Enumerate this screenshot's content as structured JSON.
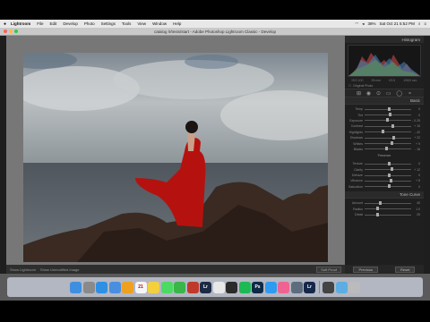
{
  "menubar": {
    "app_name": "Lightroom",
    "items": [
      "File",
      "Edit",
      "Develop",
      "Photo",
      "Settings",
      "Tools",
      "View",
      "Window",
      "Help"
    ],
    "status": {
      "battery": "38%",
      "datetime": "Sat Oct 21  5:52 PM"
    }
  },
  "window": {
    "title": "catalog lr/tests/start - Adobe Photoshop Lightroom Classic - Develop"
  },
  "panel": {
    "histogram_title": "Histogram",
    "histogram_info": [
      "ISO 100",
      "35 mm",
      "f/3.5",
      "1/500 sec"
    ],
    "original_photo": "Original Photo",
    "basic_title": "Basic",
    "treatment": "Color",
    "profile": "Adobe Color",
    "wb": "As Shot",
    "sliders": [
      {
        "label": "Temp",
        "value": "0",
        "pos": 0.5
      },
      {
        "label": "Tint",
        "value": "0",
        "pos": 0.52
      },
      {
        "label": "Exposure",
        "value": "- 0.25",
        "pos": 0.46
      },
      {
        "label": "Contrast",
        "value": "+ 15",
        "pos": 0.58
      },
      {
        "label": "Highlights",
        "value": "- 42",
        "pos": 0.36
      },
      {
        "label": "Shadows",
        "value": "+ 22",
        "pos": 0.6
      },
      {
        "label": "Whites",
        "value": "+ 9",
        "pos": 0.55
      },
      {
        "label": "Blacks",
        "value": "- 18",
        "pos": 0.44
      }
    ],
    "presence_label": "Presence",
    "presence_sliders": [
      {
        "label": "Texture",
        "value": "0",
        "pos": 0.5
      },
      {
        "label": "Clarity",
        "value": "+ 12",
        "pos": 0.56
      },
      {
        "label": "Dehaze",
        "value": "0",
        "pos": 0.5
      },
      {
        "label": "Vibrance",
        "value": "+ 8",
        "pos": 0.54
      },
      {
        "label": "Saturation",
        "value": "0",
        "pos": 0.5
      }
    ],
    "tone_curve_title": "Tone Curve",
    "detail_title": "Detail",
    "detail_sliders": [
      {
        "label": "Amount",
        "value": "40",
        "pos": 0.3
      },
      {
        "label": "Radius",
        "value": "1.0",
        "pos": 0.25
      },
      {
        "label": "Detail",
        "value": "25",
        "pos": 0.25
      }
    ],
    "previous_button": "Previous",
    "reset_button": "Reset"
  },
  "bottom_toolbar": {
    "mode": "Show Lightroom",
    "label": "Show Unmodified Image",
    "softproof": "Soft Proof"
  },
  "dock": {
    "apps": [
      {
        "name": "finder",
        "color": "#3e8fe0",
        "glyph": ""
      },
      {
        "name": "launchpad",
        "color": "#8a8a8a",
        "glyph": ""
      },
      {
        "name": "safari",
        "color": "#2f8fe3",
        "glyph": ""
      },
      {
        "name": "mail",
        "color": "#4a8ee0",
        "glyph": ""
      },
      {
        "name": "photos",
        "color": "#f0a020",
        "glyph": ""
      },
      {
        "name": "calendar",
        "color": "#f5f5f5",
        "glyph": "21"
      },
      {
        "name": "notes",
        "color": "#f4d03f",
        "glyph": ""
      },
      {
        "name": "messages",
        "color": "#4cd964",
        "glyph": ""
      },
      {
        "name": "facetime",
        "color": "#3ab54a",
        "glyph": ""
      },
      {
        "name": "photo-booth",
        "color": "#c0392b",
        "glyph": ""
      },
      {
        "name": "lightroom",
        "color": "#1c2b44",
        "glyph": "Lr"
      },
      {
        "name": "chrome",
        "color": "#e8e8e8",
        "glyph": ""
      },
      {
        "name": "terminal",
        "color": "#2b2b2b",
        "glyph": ""
      },
      {
        "name": "spotify",
        "color": "#1db954",
        "glyph": ""
      },
      {
        "name": "photoshop",
        "color": "#0e2a47",
        "glyph": "Ps"
      },
      {
        "name": "app-store",
        "color": "#2f9bf0",
        "glyph": ""
      },
      {
        "name": "itunes",
        "color": "#f06292",
        "glyph": ""
      },
      {
        "name": "preview",
        "color": "#5d6d7e",
        "glyph": ""
      },
      {
        "name": "lightroom-classic",
        "color": "#15284a",
        "glyph": "Lr"
      },
      {
        "name": "capture-one",
        "color": "#444444",
        "glyph": ""
      },
      {
        "name": "folder",
        "color": "#5dade2",
        "glyph": ""
      },
      {
        "name": "trash",
        "color": "#bbbbbb",
        "glyph": ""
      }
    ]
  },
  "colors": {
    "dress": "#b5120f",
    "sky": "#9da6ab",
    "sea": "#5a6168",
    "rock": "#3b2a22"
  }
}
